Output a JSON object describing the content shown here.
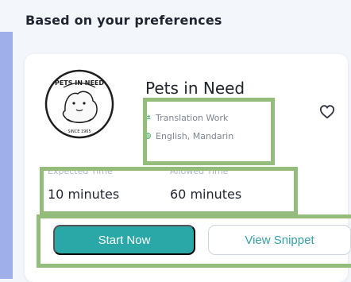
{
  "section": {
    "title": "Based on your preferences"
  },
  "card": {
    "org_name": "Pets in Need",
    "logo_text_top": "PETS IN NEED",
    "logo_text_bottom": "SINCE 1965",
    "task_type": "Translation Work",
    "languages": "English, Mandarin",
    "expected_time_label": "Expected Time",
    "expected_time_value": "10 minutes",
    "allowed_time_label": "Allowed Time",
    "allowed_time_value": "60 minutes",
    "primary_button_label": "Start Now",
    "secondary_button_label": "View Snippet"
  },
  "theme": {
    "accent": "#2aa8a8",
    "accent_text": "#37a0a8",
    "highlight": "#94bd7c",
    "left_accent": "#9eafe9",
    "page_background": "#f3f6fb",
    "card_background": "#ffffff"
  },
  "icons": {
    "favorite": "heart-outline-icon",
    "task_type": "repeat-icon",
    "language": "language-icon"
  }
}
